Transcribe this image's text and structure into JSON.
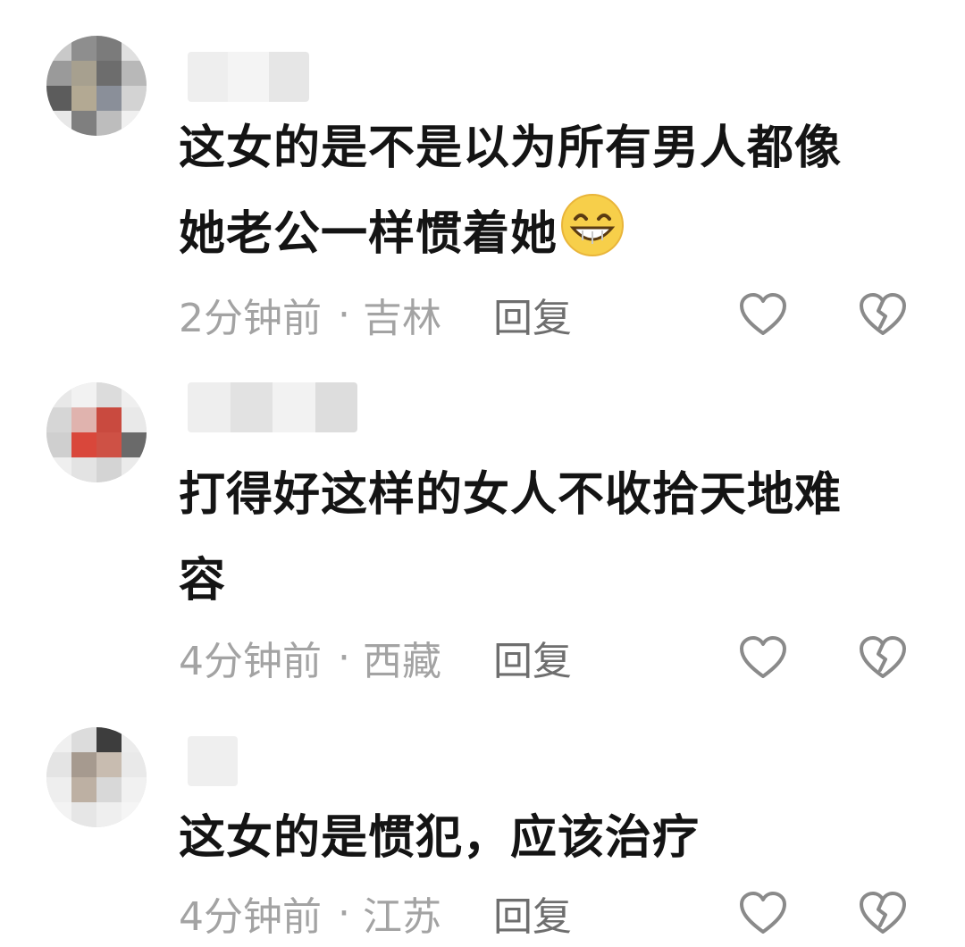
{
  "colors": {
    "text": "#141414",
    "meta": "#a3a3a3",
    "reply": "#6e6e6e",
    "icon": "#8a8a8a"
  },
  "icons": {
    "like": "heart-outline-icon",
    "dislike": "broken-heart-icon",
    "emoji": "grinning-face-emoji"
  },
  "comments": [
    {
      "text_line1": "这女的是不是以为所有男人都像",
      "text_line2": "她老公一样惯着她",
      "time": "2分钟前",
      "dot": "·",
      "region": "吉林",
      "reply_label": "回复"
    },
    {
      "text_line1": "打得好这样的女人不收拾天地难",
      "text_line2": "容",
      "time": "4分钟前",
      "dot": "·",
      "region": "西藏",
      "reply_label": "回复"
    },
    {
      "text_line1": "这女的是惯犯，应该治疗",
      "time": "4分钟前",
      "dot": "·",
      "region": "江苏",
      "reply_label": "回复"
    }
  ]
}
